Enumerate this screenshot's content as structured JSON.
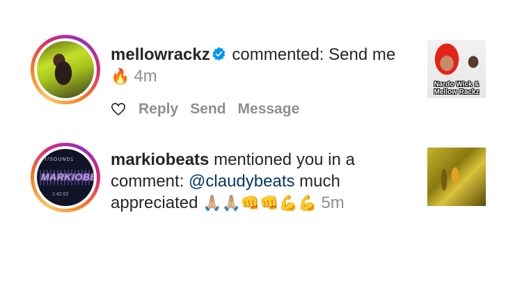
{
  "notifications": [
    {
      "username": "mellowrackz",
      "verified": true,
      "text_before": " commented: Send me ",
      "emoji": "🔥",
      "time": "4m",
      "actions": {
        "reply": "Reply",
        "send": "Send",
        "message": "Message"
      },
      "thumbnail_caption": "Nardo Wick &\nMellow Rackz"
    },
    {
      "username": "markiobeats",
      "verified": false,
      "text_before": " mentioned you in a comment: ",
      "mention": "@claudybeats",
      "text_after": " much appreciated ",
      "emoji": "🙏🏼🙏🏼👊👊💪💪",
      "time": "5m",
      "avatar_top_text": "T/SOUND1",
      "avatar_logo_text": "MARKIOBEATS",
      "avatar_time_text": "1:42:02"
    }
  ],
  "colors": {
    "text": "#262626",
    "muted": "#8e8e8e",
    "mention": "#00376b",
    "verified_badge": "#0095f6"
  }
}
